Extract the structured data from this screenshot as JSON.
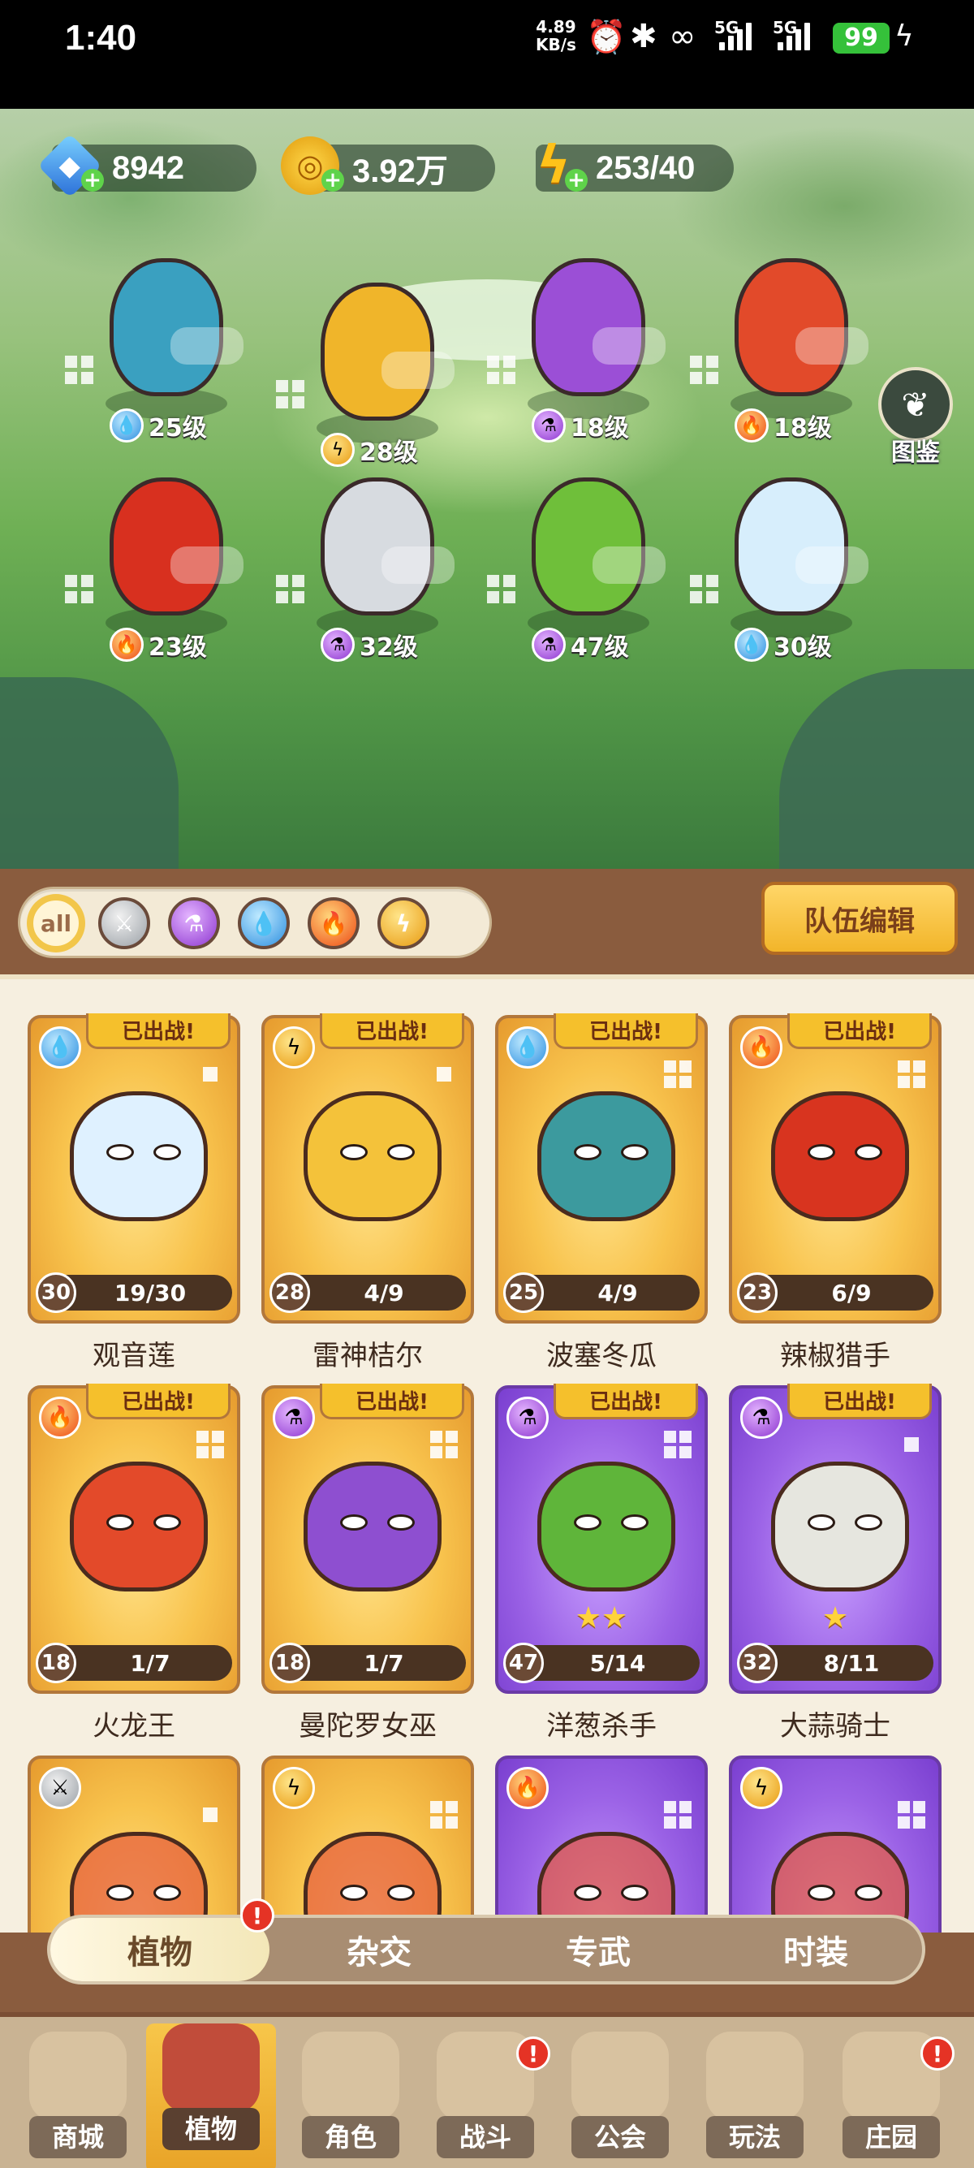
{
  "status_bar": {
    "time": "1:40",
    "net_speed_value": "4.89",
    "net_speed_unit": "KB/s",
    "signal1_label": "5G",
    "signal2_label": "5G",
    "battery": "99"
  },
  "currencies": {
    "gems": "8942",
    "coins": "3.92万",
    "energy": "253/40"
  },
  "codex_label": "图鉴",
  "team": [
    {
      "element": "water",
      "level": "25级",
      "color": "#3aa0c0"
    },
    {
      "element": "thunder",
      "level": "28级",
      "color": "#f0b52a"
    },
    {
      "element": "poison",
      "level": "18级",
      "color": "#9b4fd6"
    },
    {
      "element": "fire",
      "level": "18级",
      "color": "#e24a2a"
    },
    {
      "element": "fire",
      "level": "23级",
      "color": "#d8301f"
    },
    {
      "element": "poison",
      "level": "32级",
      "color": "#d7dbe0"
    },
    {
      "element": "poison",
      "level": "47级",
      "color": "#6fbf3a"
    },
    {
      "element": "water",
      "level": "30级",
      "color": "#d7eefc"
    }
  ],
  "filters": {
    "all_label": "all",
    "elements": [
      "steel",
      "poison",
      "water",
      "fire",
      "thunder"
    ]
  },
  "team_edit_label": "队伍编辑",
  "deployed_tag": "已出战!",
  "cards": [
    {
      "name": "观音莲",
      "element": "water",
      "level": "30",
      "progress": "19/30",
      "stars": "",
      "theme": "gold",
      "slot": "small",
      "art": "#dff1ff"
    },
    {
      "name": "雷神桔尔",
      "element": "thunder",
      "level": "28",
      "progress": "4/9",
      "stars": "",
      "theme": "gold",
      "slot": "small",
      "art": "#f4c23a"
    },
    {
      "name": "波塞冬瓜",
      "element": "water",
      "level": "25",
      "progress": "4/9",
      "stars": "",
      "theme": "gold",
      "slot": "grid",
      "art": "#3c9a9e"
    },
    {
      "name": "辣椒猎手",
      "element": "fire",
      "level": "23",
      "progress": "6/9",
      "stars": "",
      "theme": "gold",
      "slot": "grid",
      "art": "#d8341f"
    },
    {
      "name": "火龙王",
      "element": "fire",
      "level": "18",
      "progress": "1/7",
      "stars": "",
      "theme": "gold",
      "slot": "grid",
      "art": "#e34a2a"
    },
    {
      "name": "曼陀罗女巫",
      "element": "poison",
      "level": "18",
      "progress": "1/7",
      "stars": "",
      "theme": "gold",
      "slot": "grid",
      "art": "#8e4fd0"
    },
    {
      "name": "洋葱杀手",
      "element": "poison",
      "level": "47",
      "progress": "5/14",
      "stars": "★★",
      "theme": "purple",
      "slot": "grid",
      "art": "#5fb53a"
    },
    {
      "name": "大蒜骑士",
      "element": "poison",
      "level": "32",
      "progress": "8/11",
      "stars": "★",
      "theme": "purple",
      "slot": "small",
      "art": "#e6e6df"
    }
  ],
  "partial_cards": [
    {
      "element": "steel",
      "theme": "gold",
      "slot": "small"
    },
    {
      "element": "thunder",
      "theme": "gold",
      "slot": "grid"
    },
    {
      "element": "fire",
      "theme": "purple",
      "slot": "grid"
    },
    {
      "element": "thunder",
      "theme": "purple",
      "slot": "grid"
    }
  ],
  "subtabs": [
    "植物",
    "杂交",
    "专武",
    "时装"
  ],
  "nav": [
    "商城",
    "植物",
    "角色",
    "战斗",
    "公会",
    "玩法",
    "庄园"
  ],
  "badge_symbol": "!"
}
